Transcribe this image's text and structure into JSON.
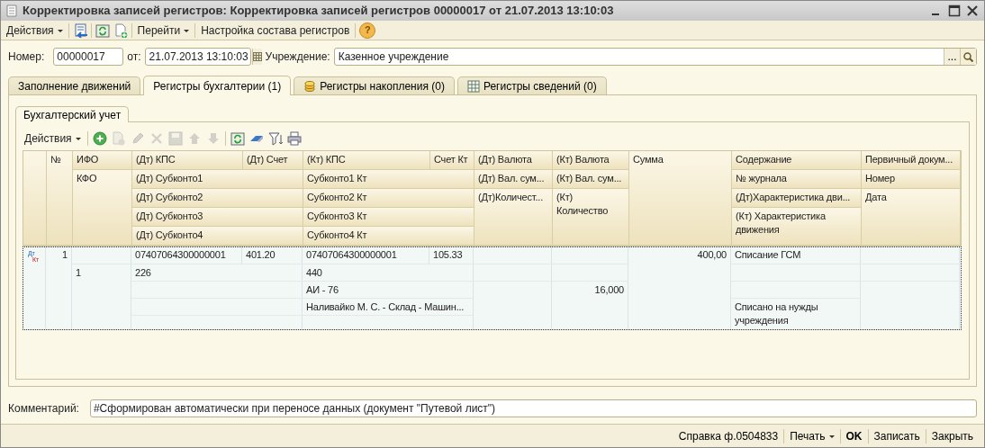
{
  "window": {
    "title": "Корректировка записей регистров: Корректировка записей регистров 00000017 от 21.07.2013 13:10:03"
  },
  "toolbar": [
    {
      "kind": "menu",
      "label": "Действия"
    },
    {
      "kind": "list-arrow"
    },
    {
      "kind": "refresh"
    },
    {
      "kind": "doc-add"
    },
    {
      "kind": "menu",
      "label": "Перейти"
    },
    {
      "kind": "link",
      "label": "Настройка состава регистров"
    },
    {
      "kind": "help",
      "label": "?"
    }
  ],
  "form": {
    "number_label": "Номер:",
    "number": "00000017",
    "date_label": "от:",
    "date": "21.07.2013 13:10:03",
    "org_label": "Учреждение:",
    "org": "Казенное учреждение",
    "select_button": "..."
  },
  "tabs": [
    {
      "label": "Заполнение движений",
      "selected": false,
      "kind": "plain"
    },
    {
      "label": "Регистры бухгалтерии (1)",
      "selected": true,
      "kind": "plain"
    },
    {
      "label": "Регистры накопления (0)",
      "selected": false,
      "kind": "coins"
    },
    {
      "label": "Регистры сведений (0)",
      "selected": false,
      "kind": "table"
    }
  ],
  "subtabs": [
    {
      "label": "Бухгалтерский учет",
      "selected": true
    }
  ],
  "grid_toolbar": [
    {
      "kind": "menu",
      "label": "Действия"
    },
    {
      "kind": "add",
      "disabled": false
    },
    {
      "kind": "copy",
      "disabled": true
    },
    {
      "kind": "edit",
      "disabled": true
    },
    {
      "kind": "delete",
      "disabled": true
    },
    {
      "kind": "save",
      "disabled": true
    },
    {
      "kind": "up",
      "disabled": true
    },
    {
      "kind": "down",
      "disabled": true
    },
    {
      "kind": "refresh",
      "disabled": false
    },
    {
      "kind": "eraser",
      "disabled": false
    },
    {
      "kind": "filter",
      "disabled": false
    },
    {
      "kind": "print",
      "disabled": false
    }
  ],
  "table": {
    "header": [
      "№",
      "ИФО",
      "КФО",
      "(Дт) КПС",
      "(Дт) Счет",
      "(Кт) КПС",
      "Счет Кт",
      "(Дт) Валюта",
      "(Кт) Валюта",
      "Сумма",
      "Содержание",
      "Первичный докум...",
      "(Дт) Субконто1",
      "Субконто1 Кт",
      "(Дт) Вал. сум...",
      "(Кт) Вал. сум...",
      "№ журнала",
      "Номер",
      "(Дт) Субконто2",
      "Субконто2 Кт",
      "(Дт)Количест...",
      "(Кт) Количество",
      "(Дт)Характеристика дви...",
      "Дата",
      "(Дт) Субконто3",
      "Субконто3 Кт",
      "(Кт) Характеристика движения",
      "(Дт) Субконто4",
      "Субконто4 Кт"
    ],
    "rows": [
      {
        "selected": true,
        "marker_debit": "Дт",
        "marker_credit": "Кт",
        "cells": [
          "1",
          null,
          "1",
          "07407064300000001",
          "401.20",
          "07407064300000001",
          "105.33",
          null,
          null,
          "400,00",
          "Списание ГСМ",
          null,
          "226",
          "440",
          null,
          null,
          null,
          null,
          null,
          "АИ - 76",
          null,
          "16,000",
          null,
          null,
          null,
          "Наливайко М. С. - Склад - Машин...",
          "Списано на нужды учреждения",
          null,
          null
        ]
      }
    ]
  },
  "comment": {
    "label": "Комментарий:",
    "value": "#Сформирован автоматически при переносе данных (документ \"Путевой лист\")"
  },
  "footer_buttons": [
    {
      "label": "Справка ф.0504833",
      "kind": "plain"
    },
    {
      "label": "Печать",
      "kind": "menu"
    },
    {
      "label": "OK",
      "kind": "default"
    },
    {
      "label": "Записать",
      "kind": "plain"
    },
    {
      "label": "Закрыть",
      "kind": "plain"
    }
  ]
}
